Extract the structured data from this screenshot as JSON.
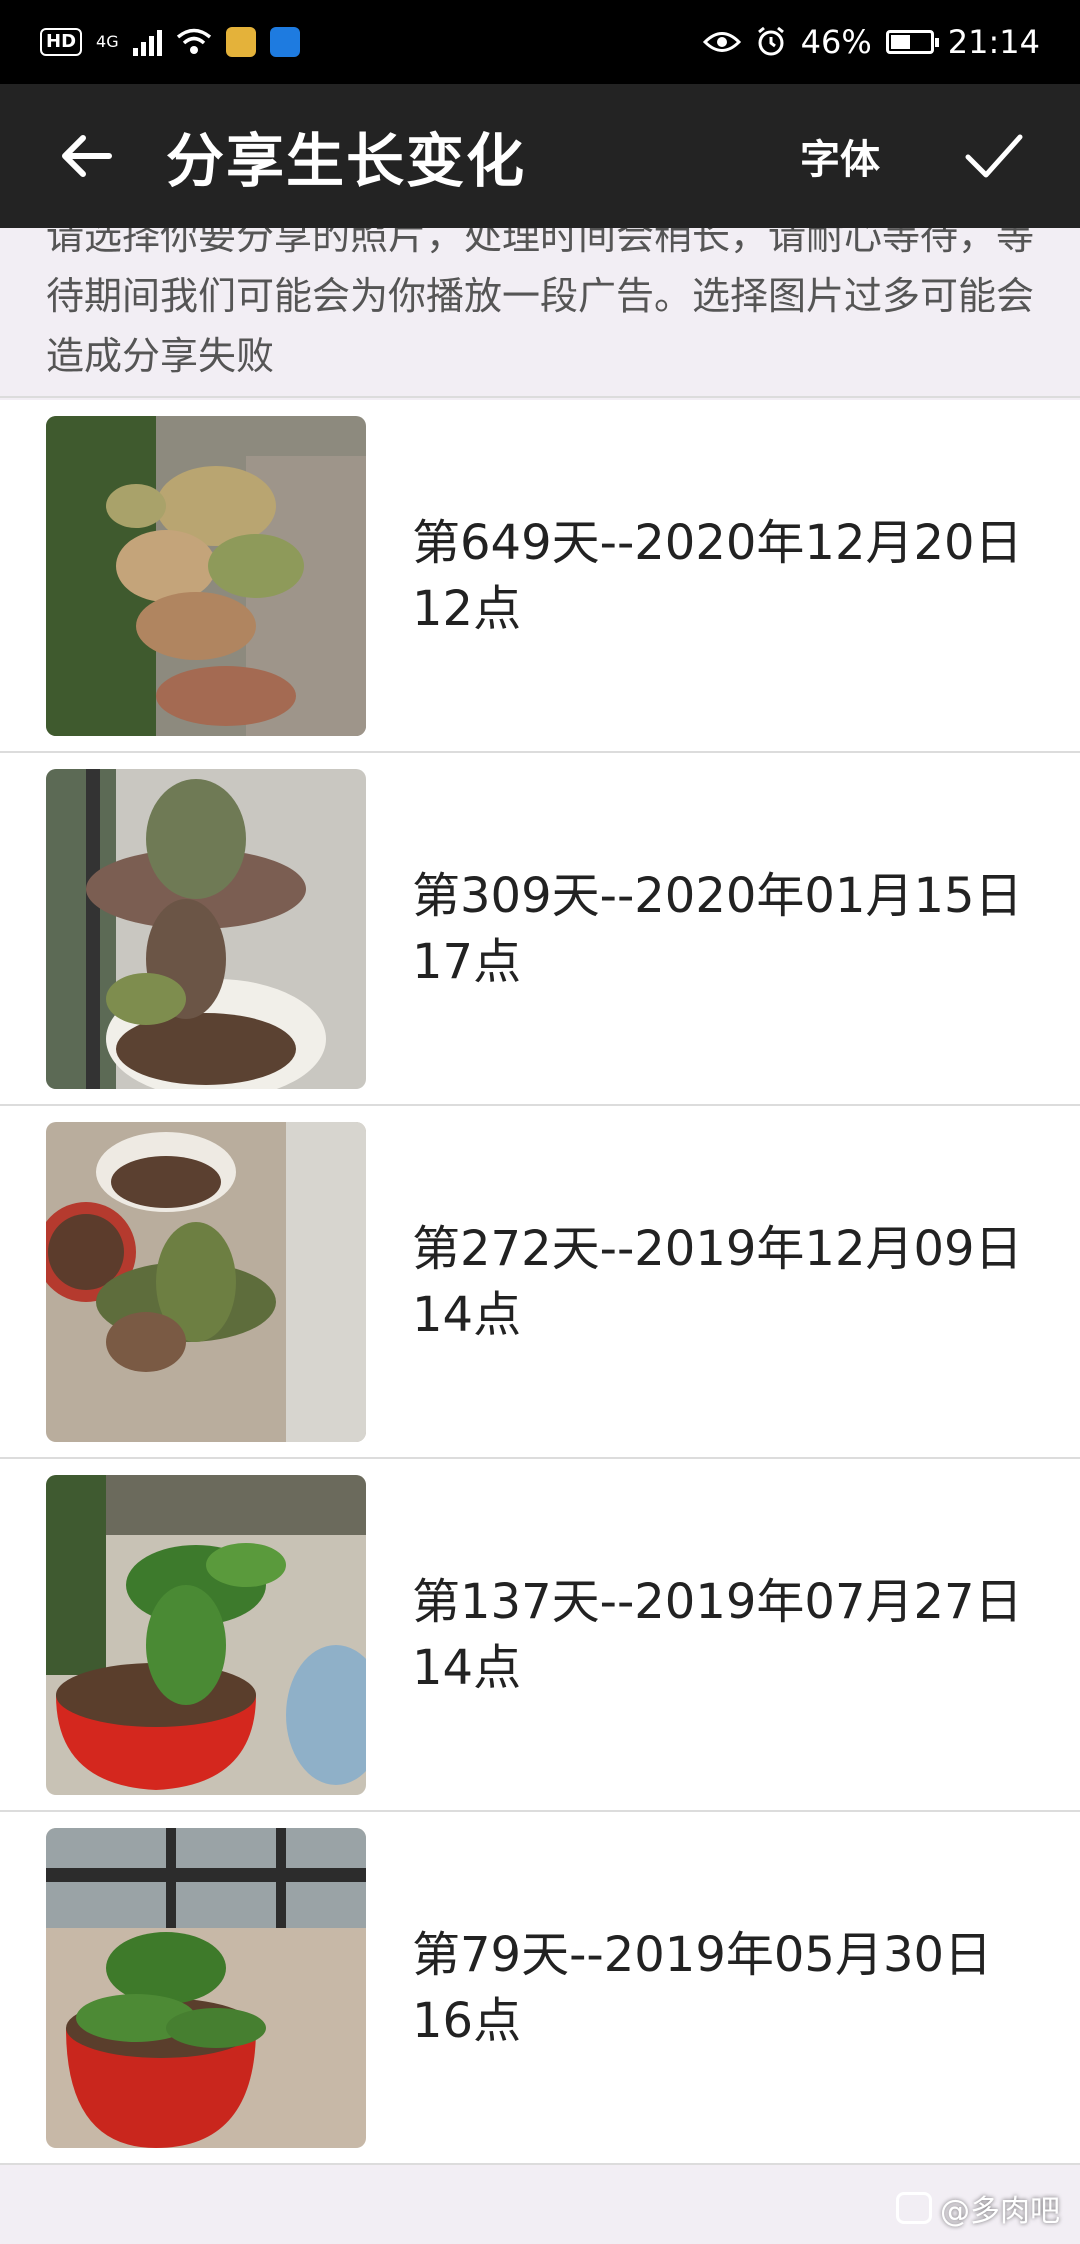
{
  "status_bar": {
    "hd": "HD",
    "network": "4G",
    "battery_percent": "46%",
    "battery_level": 0.46,
    "time": "21:14"
  },
  "app_bar": {
    "title": "分享生长变化",
    "font_label": "字体"
  },
  "notice": {
    "text": "请选择你要分享的照片，处理时间会稍长，请耐心等待，等待期间我们可能会为你播放一段广告。选择图片过多可能会造成分享失败"
  },
  "entries": [
    {
      "line1": "第649天--2020年12月20日",
      "line2": "12点"
    },
    {
      "line1": "第309天--2020年01月15日",
      "line2": "17点"
    },
    {
      "line1": "第272天--2019年12月09日",
      "line2": "14点"
    },
    {
      "line1": "第137天--2019年07月27日",
      "line2": "14点"
    },
    {
      "line1": "第79天--2019年05月30日",
      "line2": "16点"
    }
  ],
  "watermark": {
    "text": "@多肉吧"
  },
  "colors": {
    "app_bar_bg": "#232323",
    "page_bg": "#f2eef4",
    "divider": "#dcdcdc"
  }
}
